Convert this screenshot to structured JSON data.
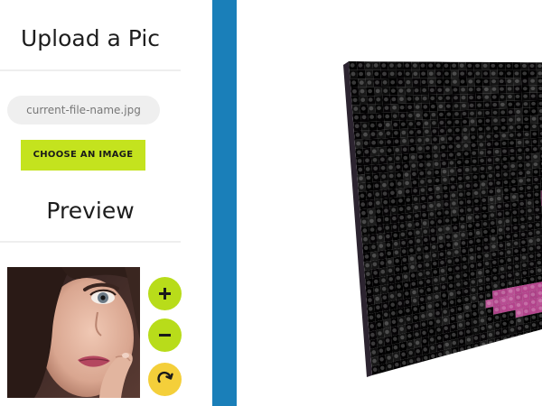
{
  "upload": {
    "title": "Upload a Pic",
    "file_name": "current-file-name.jpg",
    "choose_label": "CHOOSE AN IMAGE"
  },
  "preview": {
    "title": "Preview",
    "controls": {
      "zoom_in_icon": "plus-icon",
      "zoom_out_icon": "minus-icon",
      "rotate_icon": "rotate-clockwise-icon"
    }
  },
  "colors": {
    "accent_green": "#c4e31e",
    "zoom_button": "#b8dc1a",
    "rotate_button": "#f4cf3a",
    "divider_blue": "#1a7fb9",
    "brick_palette": [
      "#5d4459",
      "#7d5573",
      "#a9839d",
      "#c9a6b9",
      "#e2cdd6",
      "#9b3f86",
      "#c8488f",
      "#6a2e5b"
    ]
  }
}
